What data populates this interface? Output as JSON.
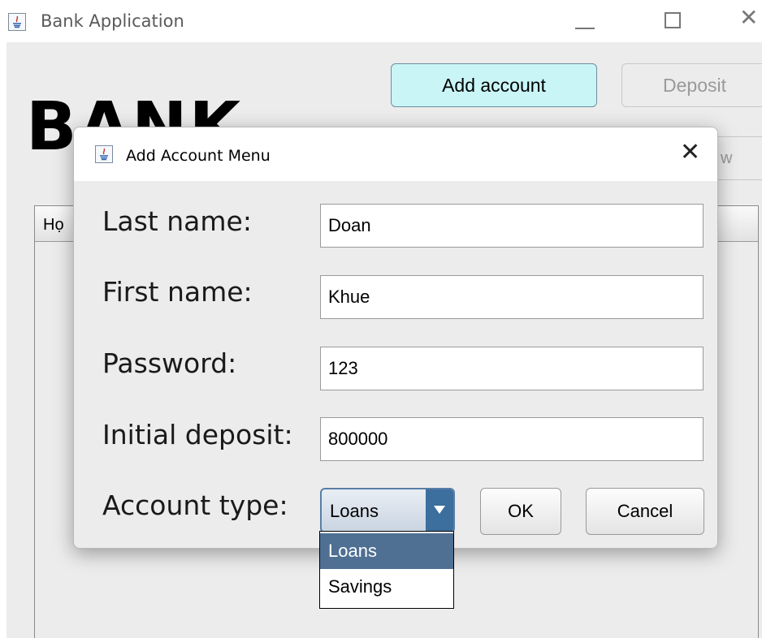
{
  "main_window": {
    "title": "Bank Application",
    "heading": "BANK",
    "buttons": {
      "add_account": "Add account",
      "deposit": "Deposit",
      "view_partial": "w"
    },
    "table": {
      "first_column_header_partial": "Họ"
    },
    "controls": {
      "minimize": "minimize-icon",
      "maximize": "maximize-icon",
      "close": "close-icon"
    }
  },
  "dialog": {
    "title": "Add Account Menu",
    "close_symbol": "✕",
    "fields": [
      {
        "label": "Last name:",
        "value": "Doan"
      },
      {
        "label": "First name:",
        "value": "Khue"
      },
      {
        "label": "Password:",
        "value": "123"
      },
      {
        "label": "Initial deposit:",
        "value": "800000"
      }
    ],
    "account_type": {
      "label": "Account type:",
      "selected": "Loans",
      "options": [
        "Loans",
        "Savings"
      ]
    },
    "buttons": {
      "ok": "OK",
      "cancel": "Cancel"
    }
  },
  "colors": {
    "add_button_bg": "#c9f5f7",
    "dropdown_selected_bg": "#4f6f93",
    "window_bg": "#ececec"
  }
}
